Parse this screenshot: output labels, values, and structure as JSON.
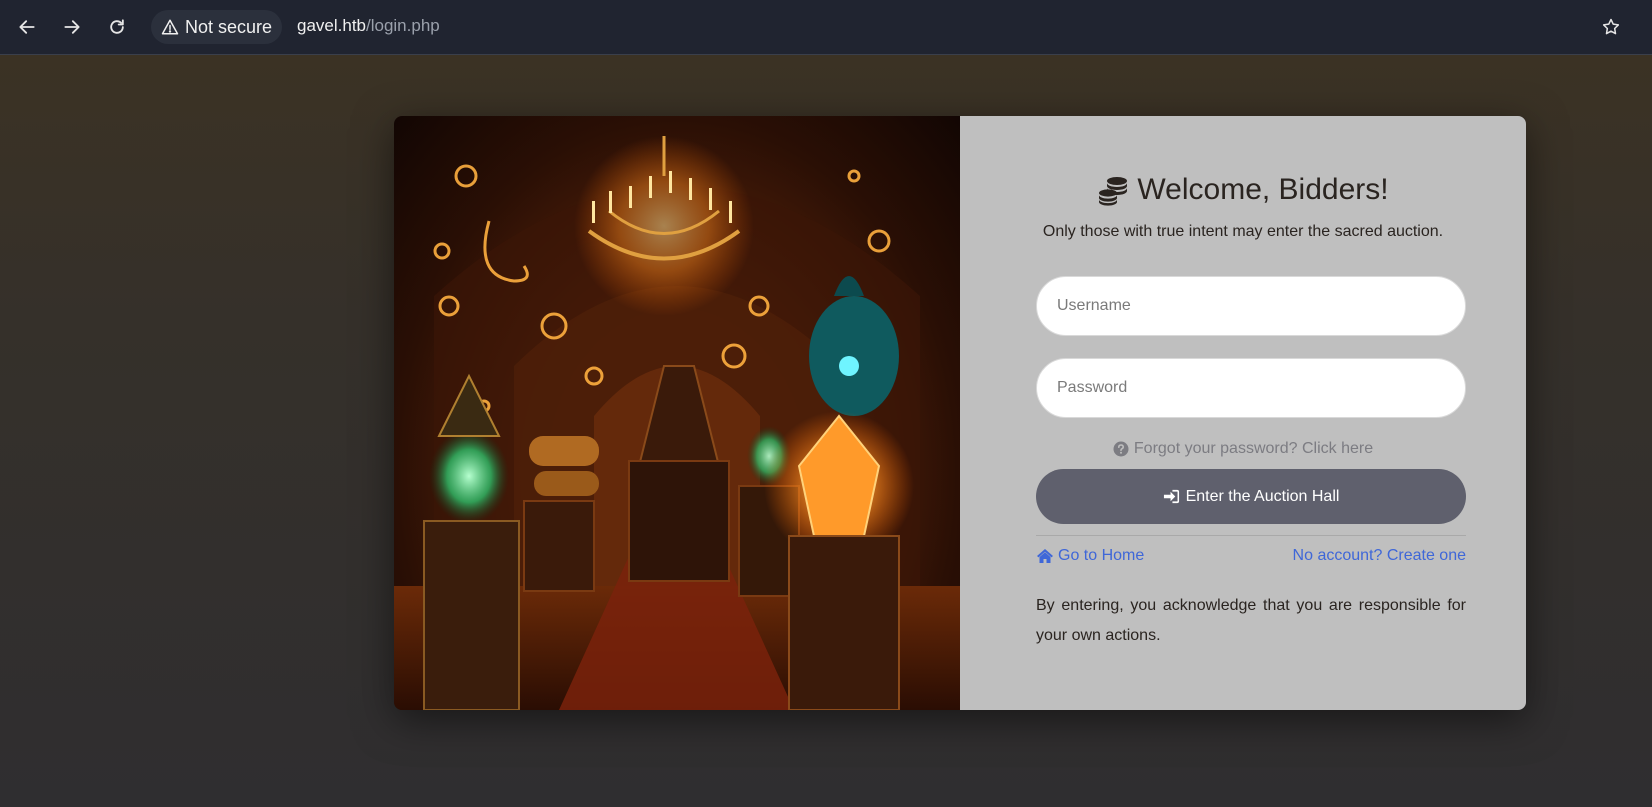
{
  "browser": {
    "security_label": "Not secure",
    "url_host": "gavel.htb",
    "url_path": "/login.php",
    "icons": [
      "back-arrow-icon",
      "forward-arrow-icon",
      "reload-icon",
      "warning-icon",
      "star-icon"
    ]
  },
  "login": {
    "title": "Welcome, Bidders!",
    "title_icon": "coins-icon",
    "subtitle": "Only those with true intent may enter the sacred auction.",
    "username_placeholder": "Username",
    "password_placeholder": "Password",
    "forgot_label": "Forgot your password? Click here",
    "submit_label": "Enter the Auction Hall",
    "home_link": "Go to Home",
    "create_link": "No account? Create one",
    "disclaimer": "By entering, you acknowledge that you are responsible for your own actions."
  },
  "colors": {
    "panel_bg": "#bfbfbf",
    "button_bg": "#5f606d",
    "link": "#3f67d8",
    "chrome_bg": "#202430"
  }
}
